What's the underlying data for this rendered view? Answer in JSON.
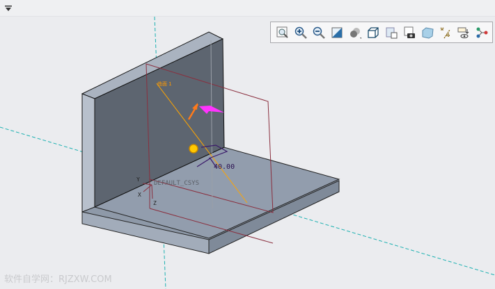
{
  "toolbar": {
    "buttons": [
      {
        "icon": "zoom-fit-icon",
        "label": "Refit"
      },
      {
        "icon": "zoom-in-icon",
        "label": "Zoom In"
      },
      {
        "icon": "zoom-out-icon",
        "label": "Zoom Out"
      },
      {
        "icon": "repaint-icon",
        "label": "Repaint"
      },
      {
        "icon": "display-style-icon",
        "label": "Display Style"
      },
      {
        "icon": "saved-orientations-icon",
        "label": "Saved Orientations"
      },
      {
        "icon": "view-manager-icon",
        "label": "View Manager"
      },
      {
        "icon": "perspective-view-icon",
        "label": "Perspective View"
      },
      {
        "icon": "section-view-icon",
        "label": "Section"
      },
      {
        "icon": "datum-display-icon",
        "label": "Datum Display Filters"
      },
      {
        "icon": "annotation-display-icon",
        "label": "Annotation Display"
      },
      {
        "icon": "spin-center-icon",
        "label": "Spin Center"
      }
    ]
  },
  "model": {
    "feature_label": "曲面 1",
    "dimension": "40.00",
    "csys_label": "DEFAULT_CSYS",
    "axes": {
      "x": "X",
      "y": "Y",
      "z": "Z"
    }
  },
  "watermark": "软件自学网：RJZXW.COM",
  "colors": {
    "plate_face": "#5d6570",
    "plate_top": "#8f9aaa",
    "datum_plane": "#8a2f3e",
    "datum_axis": "#1ab0b0",
    "dimension": "#3a1a6a",
    "highlight": "#ffa500",
    "drag_arrow": "#ff33ff"
  }
}
